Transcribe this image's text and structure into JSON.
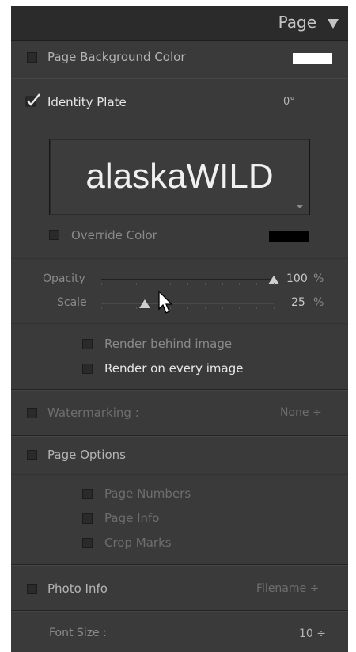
{
  "header": {
    "title": "Page"
  },
  "page_background": {
    "label": "Page Background Color",
    "swatch_color": "#ffffff"
  },
  "identity_plate": {
    "label": "Identity Plate",
    "angle": "0°",
    "plate_text": "alaskaWILD",
    "override_label": "Override Color",
    "override_swatch_color": "#000000"
  },
  "opacity": {
    "label": "Opacity",
    "value": "100",
    "unit": "%",
    "level": 1.0
  },
  "scale": {
    "label": "Scale",
    "value": "25",
    "unit": "%",
    "level": 0.25
  },
  "render": {
    "behind_label": "Render behind image",
    "every_label": "Render on every image"
  },
  "watermarking": {
    "label": "Watermarking :",
    "value": "None ÷"
  },
  "page_options": {
    "label": "Page Options",
    "items": [
      "Page Numbers",
      "Page Info",
      "Crop Marks"
    ]
  },
  "photo_info": {
    "label": "Photo Info",
    "value": "Filename ÷"
  },
  "font_size": {
    "label": "Font Size :",
    "value": "10 ÷"
  },
  "icons": {
    "collapse": "triangle-down-icon",
    "checkmark": "checkmark-icon",
    "cursor": "mouse-pointer-icon"
  }
}
